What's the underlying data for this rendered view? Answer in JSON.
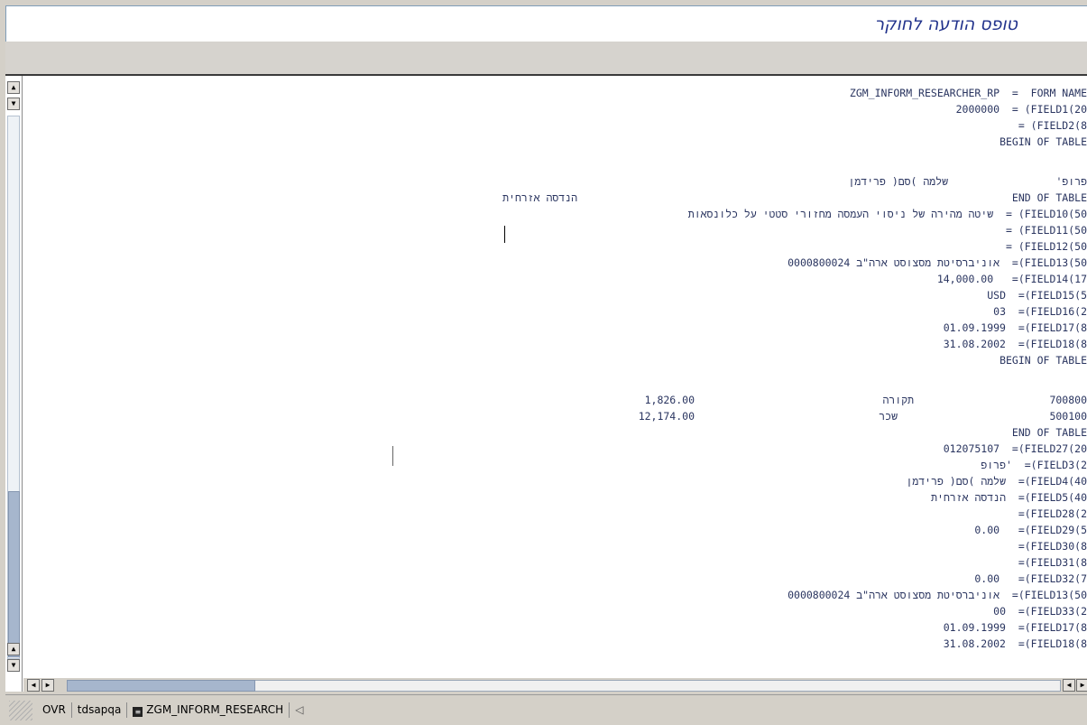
{
  "window": {
    "title": "טופס הודעה לחוקר"
  },
  "report": {
    "form_name_line": "ZGM_INFORM_RESEARCHER_RP  =  FORM NAME",
    "field1_line": "2000000  = (FIELD1(20",
    "field2_line": "= (FIELD2(8",
    "begin_table_1": "BEGIN OF TABLE",
    "table1_row": {
      "c1": "הנדסה אזרחית",
      "c2": "שלמה )סם( פרידמן",
      "c3": "פרופ'"
    },
    "end_table_1": "END OF TABLE",
    "field10_line": "שיטה מהירה של ניסוי העמסה מחזורי סטטי על כלונסאות  = (FIELD10(50",
    "field11_line": "= (FIELD11(50",
    "field12_line": "= (FIELD12(50",
    "field13_line": "0000800024 אוניברסיטת מסצוסט ארה\"ב  =(FIELD13(50",
    "field14_line": "14,000.00   =(FIELD14(17",
    "field15_line": "USD  =(FIELD15(5",
    "field16_line": "03  =(FIELD16(2",
    "field17_line": "01.09.1999  =(FIELD17(8",
    "field18_line": "31.08.2002  =(FIELD18(8",
    "begin_table_2": "BEGIN OF TABLE",
    "table2_rows": [
      {
        "amount": "1,826.00",
        "label": "תקורה",
        "code": "700800"
      },
      {
        "amount": "12,174.00",
        "label": "שכר",
        "code": "500100"
      }
    ],
    "end_table_2": "END OF TABLE",
    "field27_line": "012075107  =(FIELD27(20",
    "field3_line": "פרופ'  =(FIELD3(2",
    "field4_line": "שלמה )סם( פרידמן  =(FIELD4(40",
    "field5_line": "הנדסה אזרחית  =(FIELD5(40",
    "field28_line": "=(FIELD28(2",
    "field29_line": "0.00   =(FIELD29(5",
    "field30_line": "=(FIELD30(8",
    "field31_line": "=(FIELD31(8",
    "field32_line": "0.00   =(FIELD32(7",
    "field13b_line": "0000800024 אוניברסיטת מסצוסט ארה\"ב  =(FIELD13(50",
    "field33_line": "00  =(FIELD33(2",
    "field17b_line": "01.09.1999  =(FIELD17(8",
    "field18b_line": "31.08.2002  =(FIELD18(8"
  },
  "statusbar": {
    "mode": "OVR",
    "server": "tdsapqa",
    "program": "ZGM_INFORM_RESEARCH"
  }
}
